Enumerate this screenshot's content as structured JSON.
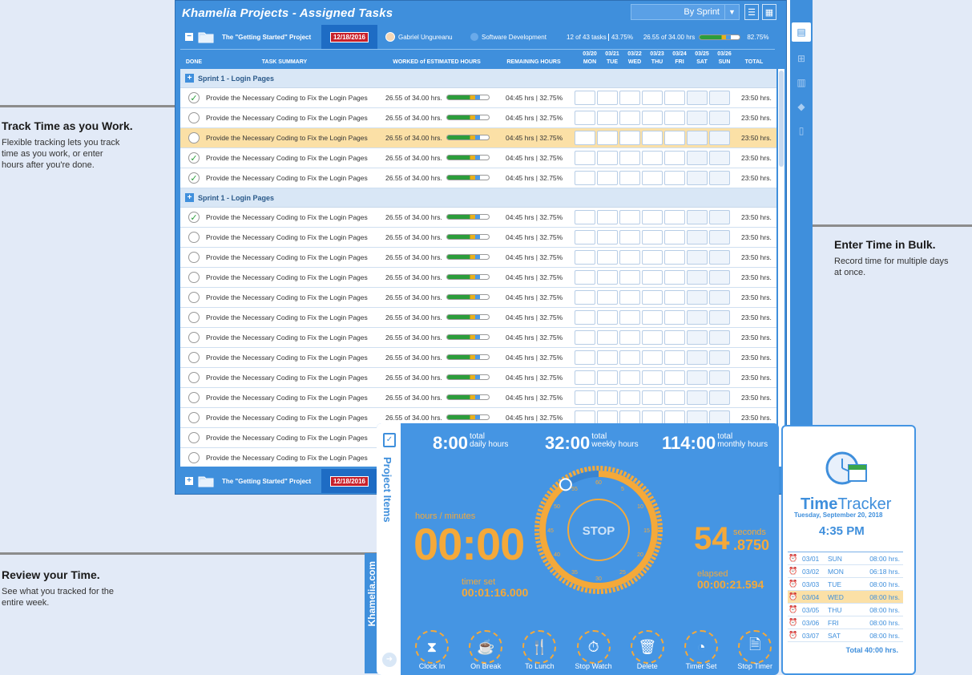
{
  "callouts": [
    {
      "title": "Track Time as you Work.",
      "body": [
        "Flexible tracking lets you track",
        "time as you work, or enter",
        "hours after you're done."
      ]
    },
    {
      "title": "Enter Time in Bulk.",
      "body": [
        "Record time for multiple days",
        "at once."
      ]
    },
    {
      "title": "Review your Time.",
      "body": [
        "See what you tracked for the",
        "entire week."
      ]
    }
  ],
  "window": {
    "title": "Khamelia Projects - Assigned Tasks",
    "sprint_select": "By Sprint"
  },
  "project_bar": {
    "name": "The \"Getting Started\" Project",
    "date": "12/18/2016",
    "user": "Gabriel Ungureanu",
    "department": "Software Development",
    "tasks": "12 of 43 tasks",
    "tasks_pct": "43.75%",
    "hours": "26.55 of 34.00 hrs",
    "hours_pct": "82.75%",
    "progress": 0.78
  },
  "columns": {
    "done": "DONE",
    "summary": "TASK SUMMARY",
    "worked": "WORKED of ESTIMATED HOURS",
    "remaining": "REMAINING HOURS",
    "total": "TOTAL",
    "days": [
      {
        "date": "03/20",
        "day": "MON"
      },
      {
        "date": "03/21",
        "day": "TUE"
      },
      {
        "date": "03/22",
        "day": "WED"
      },
      {
        "date": "03/23",
        "day": "THU"
      },
      {
        "date": "03/24",
        "day": "FRI"
      },
      {
        "date": "03/25",
        "day": "SAT"
      },
      {
        "date": "03/26",
        "day": "SUN"
      }
    ]
  },
  "groups": [
    {
      "name": "Sprint 1 - Login Pages",
      "tasks": [
        {
          "done": true,
          "summary": "Provide the Necessary Coding to Fix the Login Pages",
          "worked": "26.55 of 34.00 hrs.",
          "remaining": "04:45 hrs | 32.75%",
          "total": "23:50 hrs.",
          "highlight": false
        },
        {
          "done": false,
          "summary": "Provide the Necessary Coding to Fix the Login Pages",
          "worked": "26.55 of 34.00 hrs.",
          "remaining": "04:45 hrs | 32.75%",
          "total": "23:50 hrs.",
          "highlight": false
        },
        {
          "done": false,
          "summary": "Provide the Necessary Coding to Fix the Login Pages",
          "worked": "26.55 of 34.00 hrs.",
          "remaining": "04:45 hrs | 32.75%",
          "total": "23:50 hrs.",
          "highlight": true
        },
        {
          "done": true,
          "summary": "Provide the Necessary Coding to Fix the Login Pages",
          "worked": "26.55 of 34.00 hrs.",
          "remaining": "04:45 hrs | 32.75%",
          "total": "23:50 hrs.",
          "highlight": false
        },
        {
          "done": true,
          "summary": "Provide the Necessary Coding to Fix the Login Pages",
          "worked": "26.55 of 34.00 hrs.",
          "remaining": "04:45 hrs | 32.75%",
          "total": "23:50 hrs.",
          "highlight": false
        }
      ]
    },
    {
      "name": "Sprint 1 - Login Pages",
      "tasks": [
        {
          "done": true,
          "summary": "Provide the Necessary Coding to Fix the Login Pages",
          "worked": "26.55 of 34.00 hrs.",
          "remaining": "04:45 hrs | 32.75%",
          "total": "23:50 hrs.",
          "highlight": false
        },
        {
          "done": false,
          "summary": "Provide the Necessary Coding to Fix the Login Pages",
          "worked": "26.55 of 34.00 hrs.",
          "remaining": "04:45 hrs | 32.75%",
          "total": "23:50 hrs.",
          "highlight": false
        },
        {
          "done": false,
          "summary": "Provide the Necessary Coding to Fix the Login Pages",
          "worked": "26.55 of 34.00 hrs.",
          "remaining": "04:45 hrs | 32.75%",
          "total": "23:50 hrs.",
          "highlight": false
        },
        {
          "done": false,
          "summary": "Provide the Necessary Coding to Fix the Login Pages",
          "worked": "26.55 of 34.00 hrs.",
          "remaining": "04:45 hrs | 32.75%",
          "total": "23:50 hrs.",
          "highlight": false
        },
        {
          "done": false,
          "summary": "Provide the Necessary Coding to Fix the Login Pages",
          "worked": "26.55 of 34.00 hrs.",
          "remaining": "04:45 hrs | 32.75%",
          "total": "23:50 hrs.",
          "highlight": false
        },
        {
          "done": false,
          "summary": "Provide the Necessary Coding to Fix the Login Pages",
          "worked": "26.55 of 34.00 hrs.",
          "remaining": "04:45 hrs | 32.75%",
          "total": "23:50 hrs.",
          "highlight": false
        },
        {
          "done": false,
          "summary": "Provide the Necessary Coding to Fix the Login Pages",
          "worked": "26.55 of 34.00 hrs.",
          "remaining": "04:45 hrs | 32.75%",
          "total": "23:50 hrs.",
          "highlight": false
        },
        {
          "done": false,
          "summary": "Provide the Necessary Coding to Fix the Login Pages",
          "worked": "26.55 of 34.00 hrs.",
          "remaining": "04:45 hrs | 32.75%",
          "total": "23:50 hrs.",
          "highlight": false
        },
        {
          "done": false,
          "summary": "Provide the Necessary Coding to Fix the Login Pages",
          "worked": "26.55 of 34.00 hrs.",
          "remaining": "04:45 hrs | 32.75%",
          "total": "23:50 hrs.",
          "highlight": false
        },
        {
          "done": false,
          "summary": "Provide the Necessary Coding to Fix the Login Pages",
          "worked": "26.55 of 34.00 hrs.",
          "remaining": "04:45 hrs | 32.75%",
          "total": "23:50 hrs.",
          "highlight": false
        },
        {
          "done": false,
          "summary": "Provide the Necessary Coding to Fix the Login Pages",
          "worked": "26.55 of 34.00 hrs.",
          "remaining": "04:45 hrs | 32.75%",
          "total": "23:50 hrs.",
          "highlight": false
        },
        {
          "done": false,
          "summary": "Provide the Necessary Coding to Fix the Login Pages",
          "worked": "26.55 of 34.00 hrs.",
          "remaining": "04:45 hrs | 32.75%",
          "total": "23:50 hrs.",
          "highlight": false
        },
        {
          "done": false,
          "summary": "Provide the Necessary Coding to Fix the Login Pages",
          "worked": "26.55 of 34.00 hrs.",
          "remaining": "04:45 hrs | 32.75%",
          "total": "23:50 hrs.",
          "highlight": false
        }
      ]
    }
  ],
  "task_progress": 0.78,
  "timer": {
    "tab_label": "Project Items",
    "brand_vertical": "Khamelia.com",
    "daily": {
      "value": "8:00",
      "label1": "total",
      "label2": "daily hours"
    },
    "weekly": {
      "value": "32:00",
      "label1": "total",
      "label2": "weekly hours"
    },
    "monthly": {
      "value": "114:00",
      "label1": "total",
      "label2": "monthly hours"
    },
    "hm_label": "hours / minutes",
    "hm_value": "00:00",
    "timer_set_label": "timer set",
    "timer_set_value": "00:01:16.000",
    "seconds_value": "54",
    "seconds_label": "seconds",
    "fraction": ".8750",
    "elapsed_label": "elapsed",
    "elapsed_value": "00:00:21.594",
    "stop_label": "STOP",
    "dial_ticks": [
      "60",
      "5",
      "10",
      "15",
      "20",
      "25",
      "30",
      "35",
      "40",
      "45",
      "50",
      "55"
    ],
    "dial_progress": 0.9,
    "buttons": [
      {
        "label": "Clock In",
        "icon": "hourglass-icon",
        "glyph": "⧗"
      },
      {
        "label": "On Break",
        "icon": "coffee-cup-icon",
        "glyph": "☕"
      },
      {
        "label": "To Lunch",
        "icon": "fork-knife-icon",
        "glyph": "🍴"
      },
      {
        "label": "Stop Watch",
        "icon": "stopwatch-icon",
        "glyph": "⏱"
      },
      {
        "label": "Delete",
        "icon": "trash-icon",
        "glyph": "🗑"
      },
      {
        "label": "Timer Set",
        "icon": "pie-timer-icon",
        "glyph": "◔"
      },
      {
        "label": "Stop Timer",
        "icon": "stop-timer-icon",
        "glyph": "🗎"
      }
    ]
  },
  "tracker": {
    "brand_a": "Time",
    "brand_b": "Tracker",
    "date": "Tuesday, September 20, 2018",
    "clock": "4:35 PM",
    "days": [
      {
        "date": "03/01",
        "day": "SUN",
        "hours": "08:00 hrs.",
        "highlight": false
      },
      {
        "date": "03/02",
        "day": "MON",
        "hours": "06:18 hrs.",
        "highlight": false
      },
      {
        "date": "03/03",
        "day": "TUE",
        "hours": "08:00 hrs.",
        "highlight": false
      },
      {
        "date": "03/04",
        "day": "WED",
        "hours": "08:00 hrs.",
        "highlight": true
      },
      {
        "date": "03/05",
        "day": "THU",
        "hours": "08:00 hrs.",
        "highlight": false
      },
      {
        "date": "03/06",
        "day": "FRI",
        "hours": "08:00 hrs.",
        "highlight": false
      },
      {
        "date": "03/07",
        "day": "SAT",
        "hours": "08:00 hrs.",
        "highlight": false
      }
    ],
    "total": "Total 40:00 hrs."
  },
  "colors": {
    "accent": "#3f8fdc",
    "orange": "#f4a93a",
    "highlight": "#fbe0a6",
    "badge_red": "#c8202a"
  }
}
